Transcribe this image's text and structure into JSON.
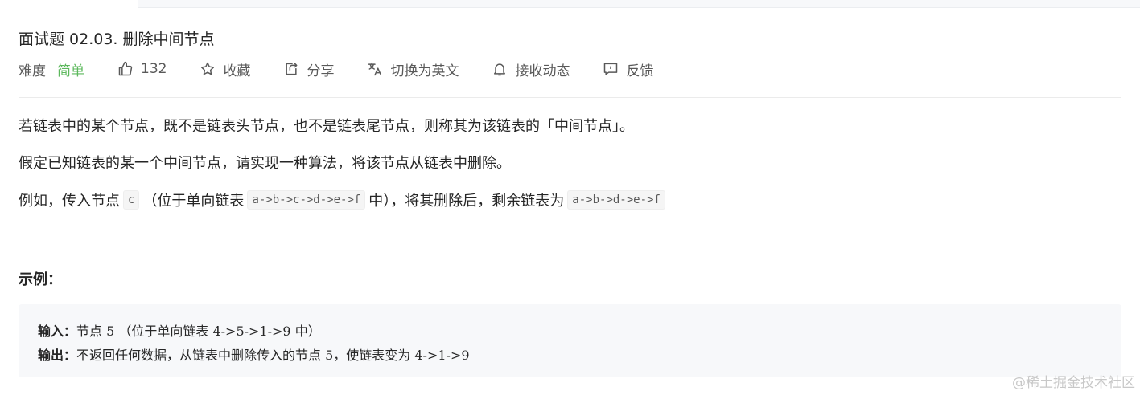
{
  "problem": {
    "title": "面试题 02.03. 删除中间节点"
  },
  "meta": {
    "difficulty_label": "难度",
    "difficulty_value": "简单",
    "likes": "132",
    "favorite_label": "收藏",
    "share_label": "分享",
    "switch_lang_label": "切换为英文",
    "subscribe_label": "接收动态",
    "feedback_label": "反馈"
  },
  "description": {
    "p1": "若链表中的某个节点，既不是链表头节点，也不是链表尾节点，则称其为该链表的「中间节点」。",
    "p2": "假定已知链表的某一个中间节点，请实现一种算法，将该节点从链表中删除。",
    "p3_pre": "例如，传入节点",
    "p3_code1": "c",
    "p3_mid1": "（位于单向链表",
    "p3_code2": "a->b->c->d->e->f",
    "p3_mid2": "中），将其删除后，剩余链表为",
    "p3_code3": "a->b->d->e->f"
  },
  "example": {
    "heading": "示例：",
    "input_label": "输入：",
    "input_text": "节点 5 （位于单向链表 4->5->1->9 中）",
    "output_label": "输出：",
    "output_text": "不返回任何数据，从链表中删除传入的节点 5，使链表变为 4->1->9"
  },
  "watermark": "@稀土掘金技术社区",
  "colors": {
    "difficulty_easy": "#5cb85c",
    "text": "#262626",
    "meta_text": "#595959",
    "example_bg": "#f7f8fa"
  }
}
